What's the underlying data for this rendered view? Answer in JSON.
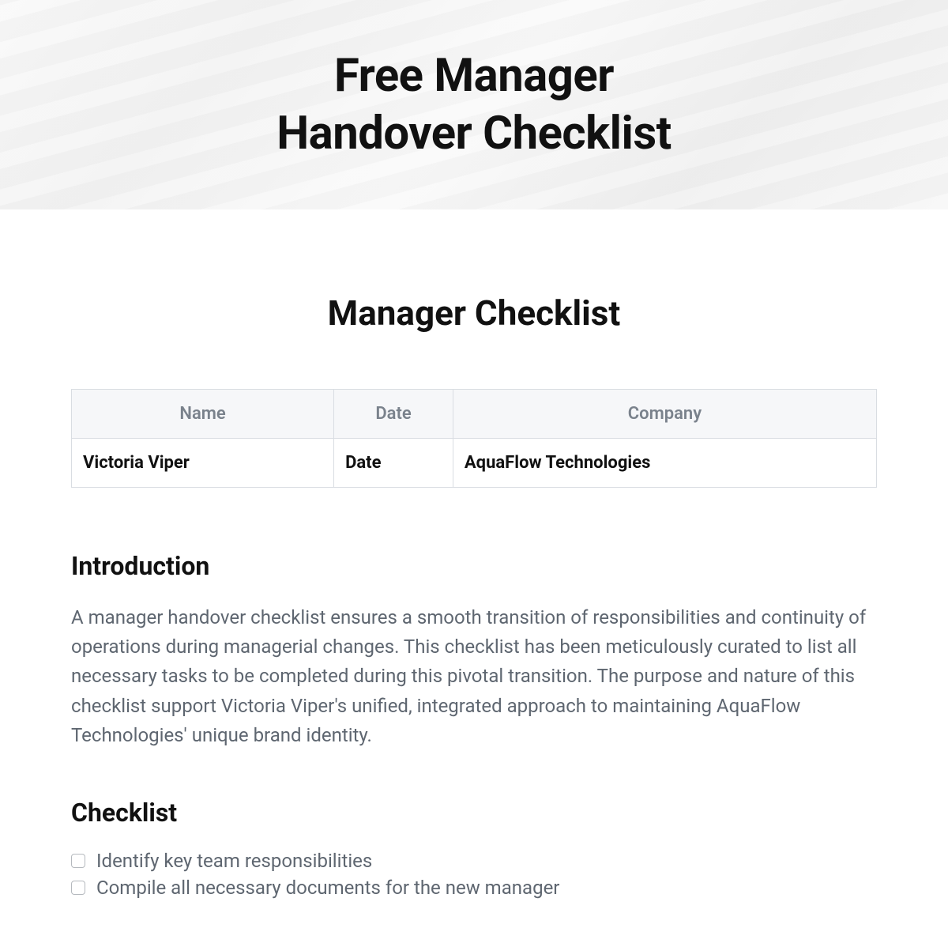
{
  "hero": {
    "title_line1": "Free Manager",
    "title_line2": "Handover Checklist"
  },
  "document": {
    "title": "Manager Checklist",
    "info_table": {
      "headers": [
        "Name",
        "Date",
        "Company"
      ],
      "row": [
        "Victoria Viper",
        "Date",
        "AquaFlow Technologies"
      ]
    },
    "introduction": {
      "heading": "Introduction",
      "body": "A manager handover checklist ensures a smooth transition of responsibilities and continuity of operations during managerial changes. This checklist has been meticulously curated to list all necessary tasks to be completed during this pivotal transition. The purpose and nature of this checklist support Victoria Viper's unified, integrated approach to maintaining AquaFlow Technologies' unique brand identity."
    },
    "checklist": {
      "heading": "Checklist",
      "items": [
        "Identify key team responsibilities",
        "Compile all necessary documents for the new manager"
      ]
    }
  }
}
